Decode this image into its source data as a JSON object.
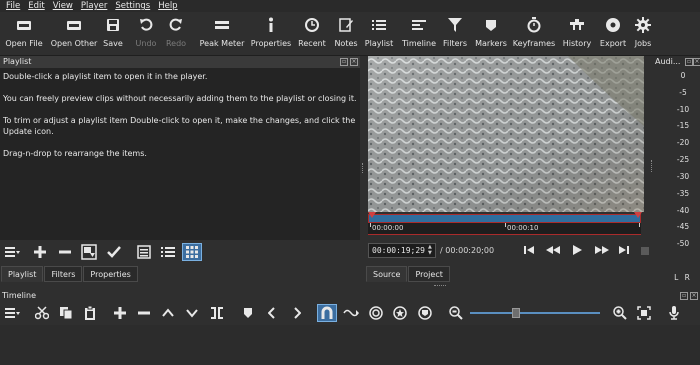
{
  "menu": [
    "File",
    "Edit",
    "View",
    "Player",
    "Settings",
    "Help"
  ],
  "toolbar": [
    {
      "label": "Open File",
      "icon": "open-file-icon",
      "enabled": true
    },
    {
      "label": "Open Other",
      "icon": "open-other-icon",
      "enabled": true
    },
    {
      "label": "Save",
      "icon": "save-icon",
      "enabled": true
    },
    {
      "label": "Undo",
      "icon": "undo-icon",
      "enabled": false
    },
    {
      "label": "Redo",
      "icon": "redo-icon",
      "enabled": false
    },
    {
      "label": "Peak Meter",
      "icon": "peak-meter-icon",
      "enabled": true
    },
    {
      "label": "Properties",
      "icon": "properties-icon",
      "enabled": true
    },
    {
      "label": "Recent",
      "icon": "clock-icon",
      "enabled": true
    },
    {
      "label": "Notes",
      "icon": "notes-icon",
      "enabled": true
    },
    {
      "label": "Playlist",
      "icon": "playlist-icon",
      "enabled": true
    },
    {
      "label": "Timeline",
      "icon": "timeline-icon",
      "enabled": true
    },
    {
      "label": "Filters",
      "icon": "filter-icon",
      "enabled": true
    },
    {
      "label": "Markers",
      "icon": "marker-icon",
      "enabled": true
    },
    {
      "label": "Keyframes",
      "icon": "stopwatch-icon",
      "enabled": true
    },
    {
      "label": "History",
      "icon": "history-icon",
      "enabled": true
    },
    {
      "label": "Export",
      "icon": "export-icon",
      "enabled": true
    },
    {
      "label": "Jobs",
      "icon": "gear-icon",
      "enabled": true
    }
  ],
  "playlist": {
    "title": "Playlist",
    "instructions": [
      "Double-click a playlist item to open it in the player.",
      "You can freely preview clips without necessarily adding them to the playlist or closing it.",
      "To trim or adjust a playlist item Double-click to open it, make the changes, and click the Update icon.",
      "Drag-n-drop to rearrange the items."
    ],
    "tabs": [
      "Playlist",
      "Filters",
      "Properties"
    ]
  },
  "player": {
    "ruler_labels": [
      "00:00:00",
      "00:00:10",
      "00:00:20"
    ],
    "timecode": "00:00:19;29",
    "duration": "/ 00:00:20;00",
    "tabs": [
      "Source",
      "Project"
    ]
  },
  "audio": {
    "title": "Audi...",
    "scale": [
      "0",
      "-5",
      "-10",
      "-15",
      "-20",
      "-25",
      "-30",
      "-35",
      "-40",
      "-45",
      "-50"
    ],
    "channels": "L R"
  },
  "timeline": {
    "title": "Timeline"
  },
  "colors": {
    "accent": "#3c6ea0",
    "scrub_track": "#2f6d9e",
    "playhead": "#aa2b2b"
  }
}
